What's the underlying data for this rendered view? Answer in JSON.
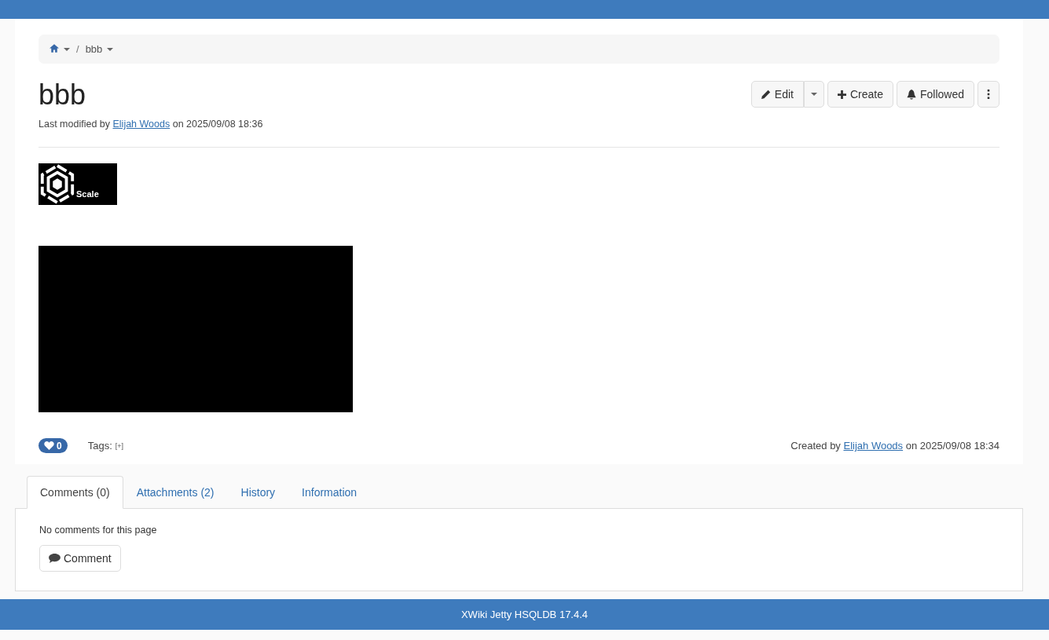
{
  "breadcrumb": {
    "separator": "/",
    "items": [
      {
        "kind": "home"
      },
      {
        "kind": "page",
        "label": "bbb"
      }
    ]
  },
  "title": "bbb",
  "last_modified": {
    "prefix": "Last modified by",
    "author": "Elijah Woods",
    "suffix": "on 2025/09/08 18:36"
  },
  "actions": [
    {
      "kind": "edit",
      "label": "Edit"
    },
    {
      "kind": "create",
      "label": "Create"
    },
    {
      "kind": "follow",
      "label": "Followed"
    },
    {
      "kind": "more"
    }
  ],
  "content": [
    {
      "kind": "logo",
      "text": "Scale"
    },
    {
      "kind": "picture"
    }
  ],
  "likes": "0",
  "tags": {
    "label": "Tags:",
    "add": "[+]"
  },
  "created": {
    "prefix": "Created by",
    "author": "Elijah Woods",
    "suffix": "on 2025/09/08 18:34"
  },
  "tabs": [
    {
      "label": "Comments (0)",
      "selected": true
    },
    {
      "label": "Attachments (2)",
      "selected": false
    },
    {
      "label": "History",
      "selected": false
    },
    {
      "label": "Information",
      "selected": false
    }
  ],
  "comments": {
    "empty_text": "No comments for this page",
    "button": "Comment"
  },
  "footer": "XWiki Jetty HSQLDB 17.4.4"
}
